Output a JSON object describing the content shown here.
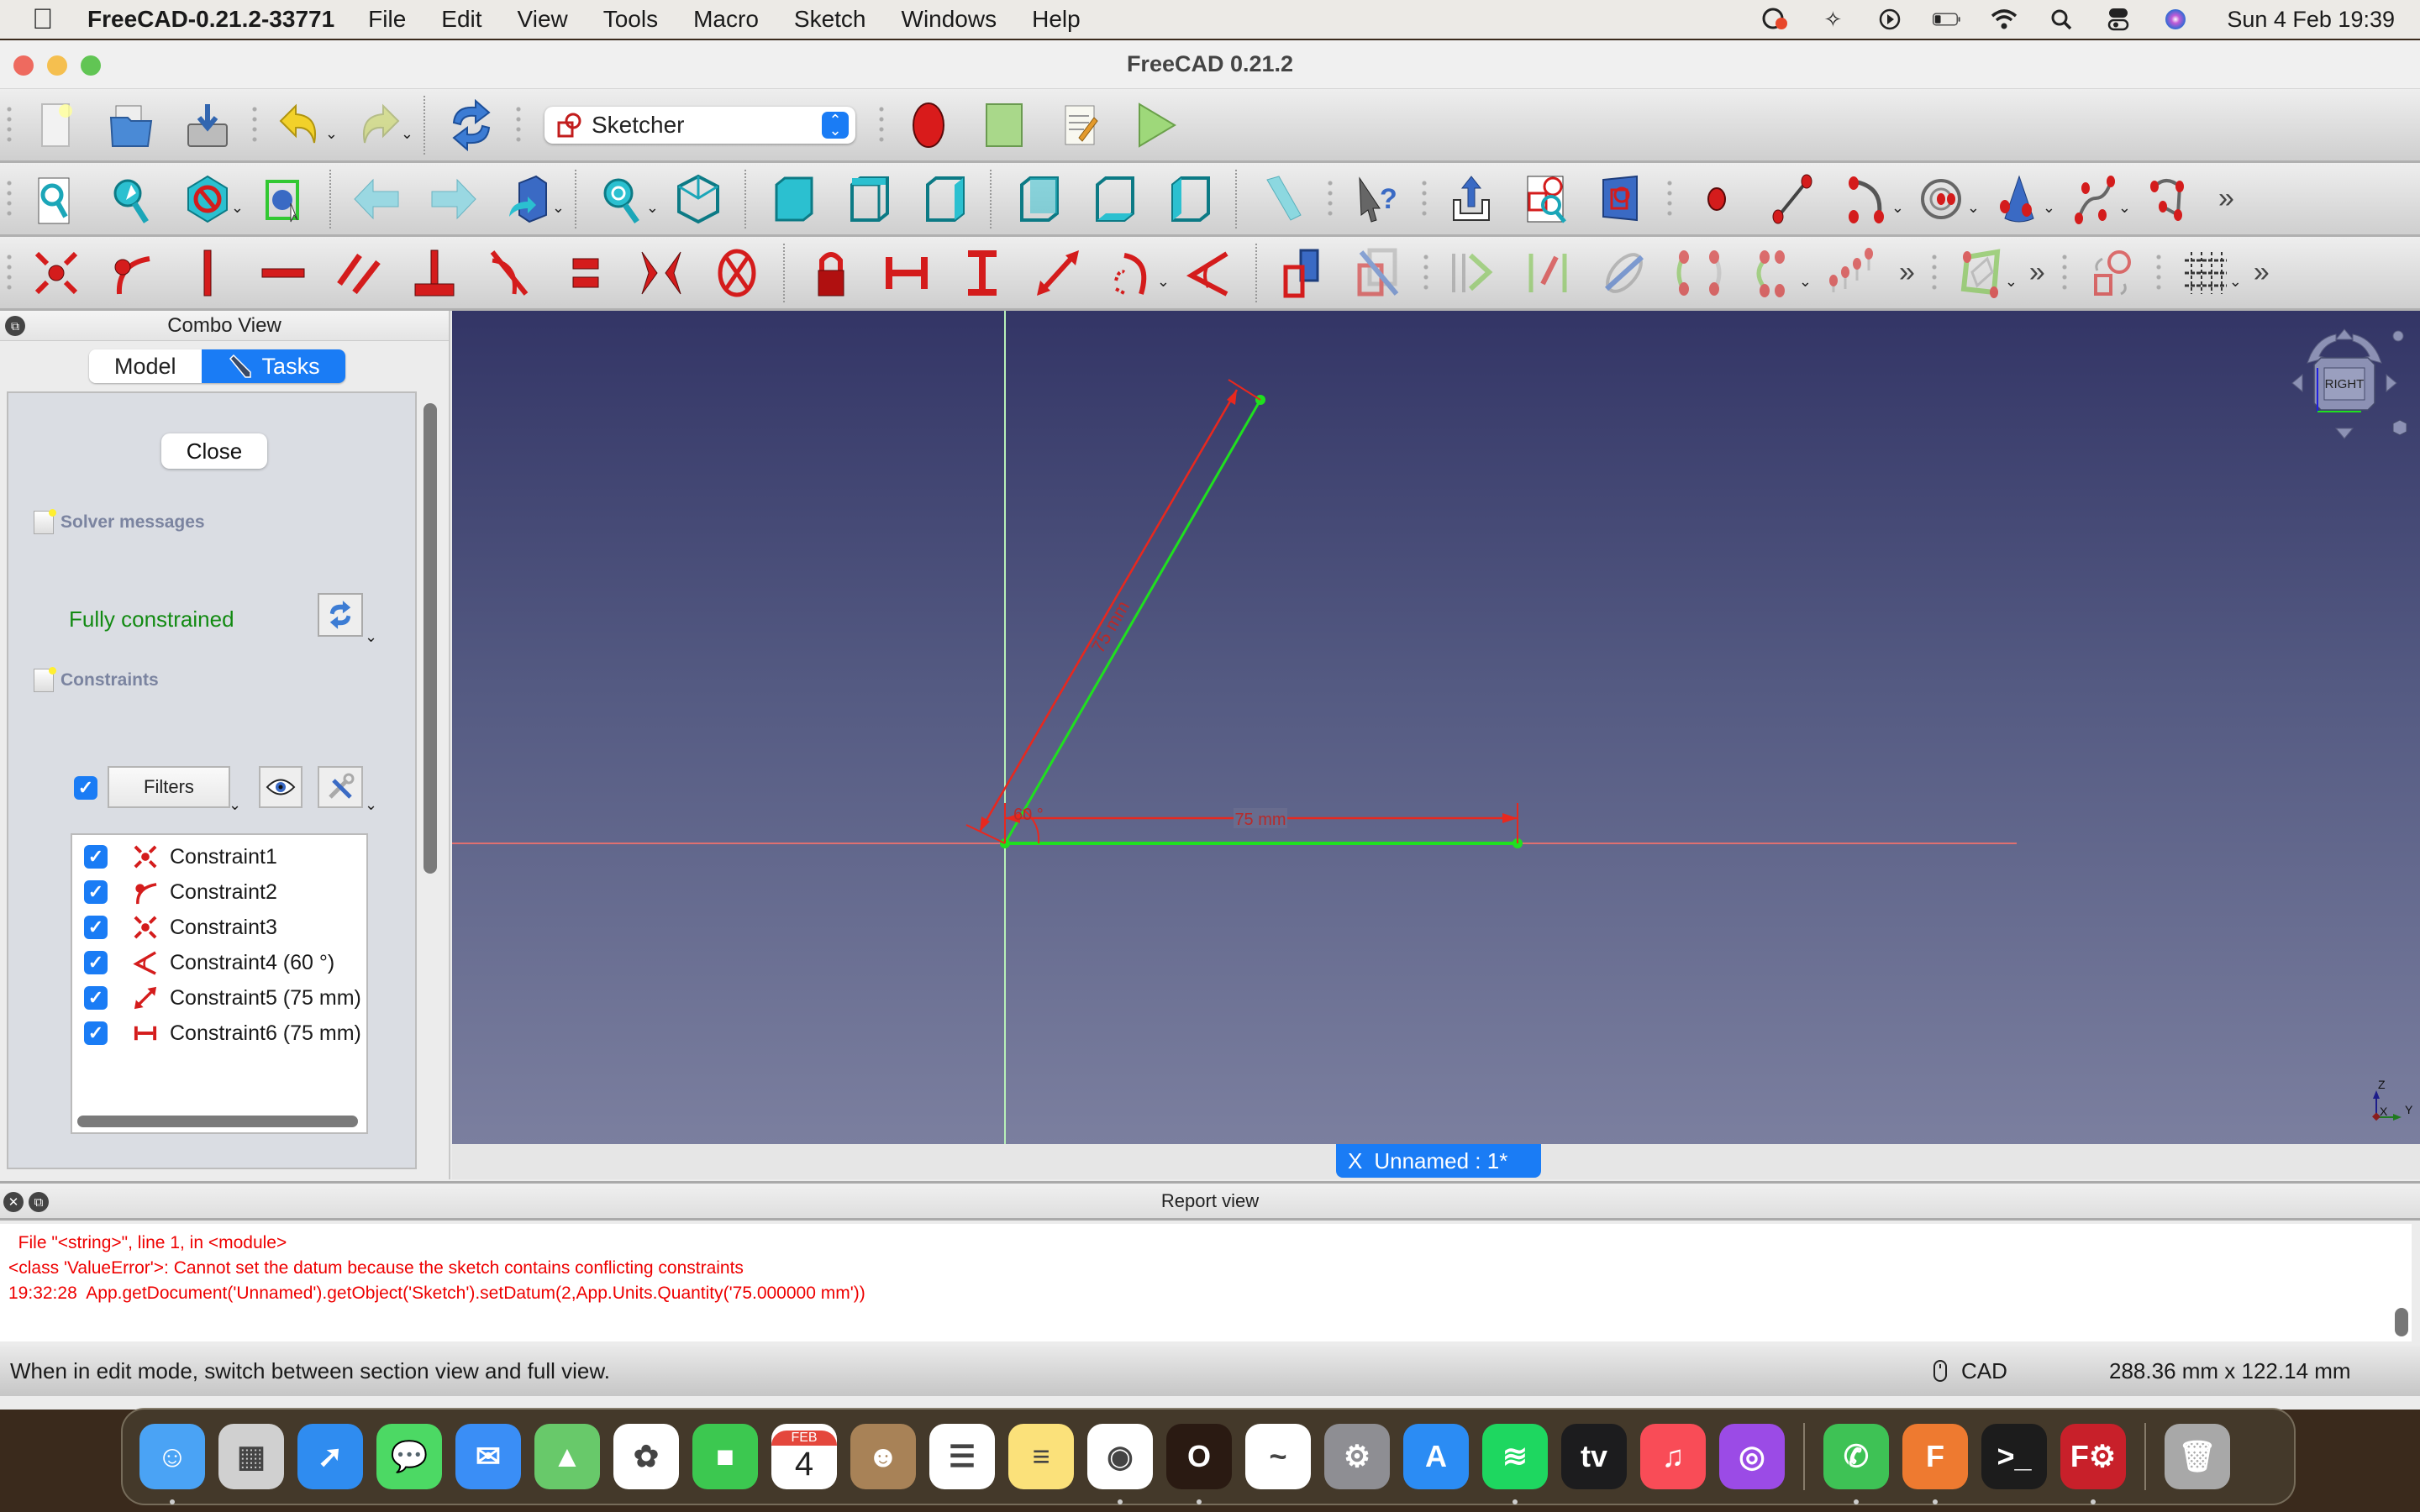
{
  "menubar": {
    "app_name": "FreeCAD-0.21.2-33771",
    "items": [
      "File",
      "Edit",
      "View",
      "Tools",
      "Macro",
      "Sketch",
      "Windows",
      "Help"
    ],
    "status_icons": [
      "creative-cloud-icon",
      "bluetooth-icon",
      "now-playing-icon",
      "battery-icon",
      "wifi-icon",
      "spotlight-search-icon",
      "control-center-icon",
      "siri-icon"
    ],
    "clock": "Sun 4 Feb  19:39"
  },
  "window": {
    "title": "FreeCAD 0.21.2"
  },
  "toolbar": {
    "workbench": "Sketcher"
  },
  "combo_view": {
    "title": "Combo View",
    "tabs": [
      {
        "label": "Model",
        "active": false
      },
      {
        "label": "Tasks",
        "active": true
      }
    ],
    "close_label": "Close",
    "solver_section": "Solver messages",
    "solver_status": "Fully constrained",
    "constraints_section": "Constraints",
    "filters_label": "Filters",
    "filters_checked": true,
    "constraints": [
      {
        "label": "Constraint1",
        "type": "coincident",
        "checked": true
      },
      {
        "label": "Constraint2",
        "type": "point-on-object",
        "checked": true
      },
      {
        "label": "Constraint3",
        "type": "coincident",
        "checked": true
      },
      {
        "label": "Constraint4 (60 °)",
        "type": "angle",
        "checked": true
      },
      {
        "label": "Constraint5 (75 mm)",
        "type": "distance",
        "checked": true
      },
      {
        "label": "Constraint6 (75 mm)",
        "type": "horizontal-distance",
        "checked": true
      }
    ]
  },
  "view3d": {
    "navcube_face": "RIGHT",
    "dimension_labels": {
      "angle": "60 °",
      "inclined_length": "75 mm",
      "horizontal_length": "75 mm"
    },
    "axis_labels": {
      "z": "Z",
      "x": "X",
      "y": "Y"
    },
    "colors": {
      "geometry": "#1fe01f",
      "constraint": "#e8281e"
    }
  },
  "document_tab": {
    "label": "Unnamed : 1*",
    "close_glyph": "X"
  },
  "report_view": {
    "title": "Report view",
    "lines": [
      "  File \"<string>\", line 1, in <module>",
      "<class 'ValueError'>: Cannot set the datum because the sketch contains conflicting constraints",
      "19:32:28  App.getDocument('Unnamed').getObject('Sketch').setDatum(2,App.Units.Quantity('75.000000 mm'))"
    ]
  },
  "statusbar": {
    "message": "When in edit mode, switch between section view and full view.",
    "nav_style": "CAD",
    "dimensions": "288.36 mm x 122.14 mm"
  },
  "dock": {
    "apps": [
      {
        "name": "Finder",
        "running": true,
        "bg": "#4aa3f5",
        "glyph": "☺"
      },
      {
        "name": "Launchpad",
        "running": false,
        "bg": "#d0d0d0",
        "glyph": "▦"
      },
      {
        "name": "Safari",
        "running": false,
        "bg": "#2f8cf0",
        "glyph": "➚"
      },
      {
        "name": "Messages",
        "running": false,
        "bg": "#4cd964",
        "glyph": "💬"
      },
      {
        "name": "Mail",
        "running": false,
        "bg": "#3a8ef6",
        "glyph": "✉"
      },
      {
        "name": "Maps",
        "running": false,
        "bg": "#68c96a",
        "glyph": "▲"
      },
      {
        "name": "Photos",
        "running": false,
        "bg": "#ffffff",
        "glyph": "✿"
      },
      {
        "name": "FaceTime",
        "running": false,
        "bg": "#3cc850",
        "glyph": "■"
      },
      {
        "name": "Calendar",
        "running": false,
        "bg": "#ffffff",
        "glyph": "4",
        "month": "FEB"
      },
      {
        "name": "Contacts",
        "running": false,
        "bg": "#a88257",
        "glyph": "☻"
      },
      {
        "name": "Reminders",
        "running": false,
        "bg": "#ffffff",
        "glyph": "☰"
      },
      {
        "name": "Notes",
        "running": false,
        "bg": "#fbe17a",
        "glyph": "≡"
      },
      {
        "name": "Chrome",
        "running": true,
        "bg": "#ffffff",
        "glyph": "◉"
      },
      {
        "name": "Opera",
        "running": true,
        "bg": "#2a1a12",
        "glyph": "O"
      },
      {
        "name": "Freeform",
        "running": false,
        "bg": "#ffffff",
        "glyph": "~"
      },
      {
        "name": "System Settings",
        "running": false,
        "bg": "#8e8e93",
        "glyph": "⚙"
      },
      {
        "name": "App Store",
        "running": false,
        "bg": "#2b8cf4",
        "glyph": "A"
      },
      {
        "name": "Spotify",
        "running": true,
        "bg": "#1ed760",
        "glyph": "≋"
      },
      {
        "name": "Apple TV",
        "running": false,
        "bg": "#1c1c1e",
        "glyph": "tv"
      },
      {
        "name": "Music",
        "running": false,
        "bg": "#f94c57",
        "glyph": "♫"
      },
      {
        "name": "Podcasts",
        "running": false,
        "bg": "#9b4be6",
        "glyph": "◎"
      },
      {
        "name": "WhatsApp",
        "running": true,
        "bg": "#3ec255",
        "glyph": "✆"
      },
      {
        "name": "Fusion 360",
        "running": true,
        "bg": "#ee7a30",
        "glyph": "F"
      },
      {
        "name": "Terminal",
        "running": false,
        "bg": "#1c1c1c",
        "glyph": ">_"
      },
      {
        "name": "FreeCAD",
        "running": true,
        "bg": "#c8202a",
        "glyph": "F⚙"
      },
      {
        "name": "Trash",
        "running": false,
        "bg": "#a8a8a8",
        "glyph": "🗑"
      }
    ]
  }
}
